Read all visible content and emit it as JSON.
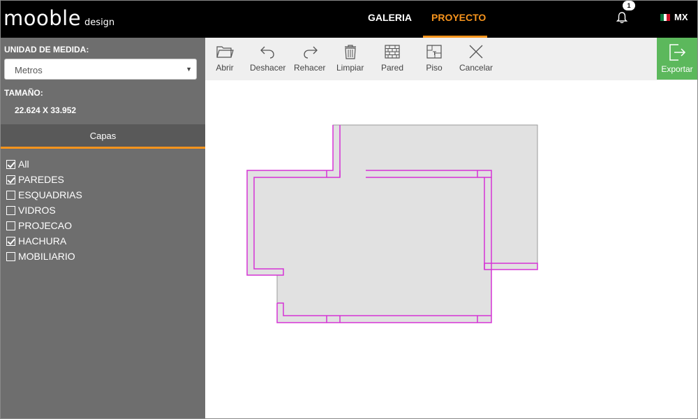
{
  "header": {
    "logo_main": "mooble",
    "logo_sub": "design",
    "tabs": [
      {
        "label": "GALERIA",
        "active": false
      },
      {
        "label": "PROYECTO",
        "active": true
      }
    ],
    "notifications_count": "1",
    "country": "MX",
    "accent_color": "#f7941d"
  },
  "sidebar": {
    "unit_label": "UNIDAD DE MEDIDA:",
    "unit_value": "Metros",
    "size_label": "TAMAÑO:",
    "size_value": "22.624 X 33.952",
    "layers_title": "Capas",
    "layers": [
      {
        "label": "All",
        "checked": true
      },
      {
        "label": "PAREDES",
        "checked": true
      },
      {
        "label": "ESQUADRIAS",
        "checked": false
      },
      {
        "label": "VIDROS",
        "checked": false
      },
      {
        "label": "PROJECAO",
        "checked": false
      },
      {
        "label": "HACHURA",
        "checked": true
      },
      {
        "label": "MOBILIARIO",
        "checked": false
      }
    ]
  },
  "toolbar": {
    "tools": [
      {
        "label": "Abrir",
        "icon": "folder-icon"
      },
      {
        "label": "Deshacer",
        "icon": "undo-icon"
      },
      {
        "label": "Rehacer",
        "icon": "redo-icon"
      },
      {
        "label": "Limpiar",
        "icon": "trash-icon"
      },
      {
        "label": "Pared",
        "icon": "wall-icon"
      },
      {
        "label": "Piso",
        "icon": "floor-icon"
      },
      {
        "label": "Cancelar",
        "icon": "close-icon"
      }
    ],
    "export_label": "Exportar",
    "export_color": "#5cb85c"
  }
}
